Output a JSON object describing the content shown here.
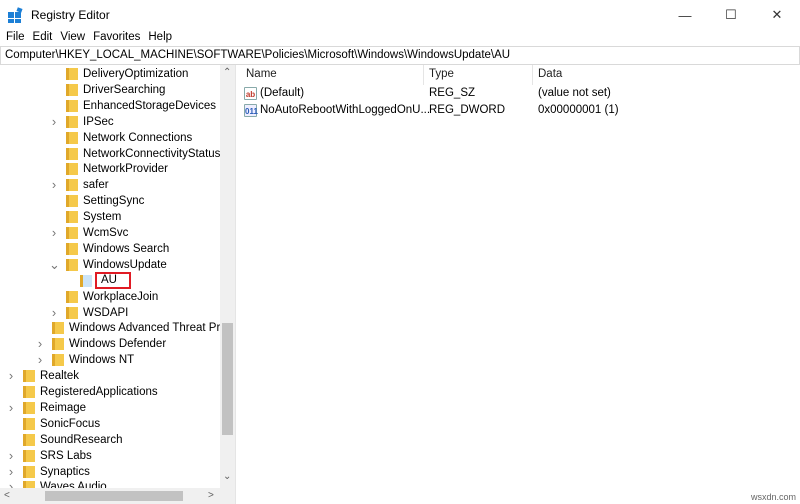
{
  "window": {
    "title": "Registry Editor",
    "minimize": "—",
    "maximize": "☐",
    "close": "✕"
  },
  "menu": [
    "File",
    "Edit",
    "View",
    "Favorites",
    "Help"
  ],
  "address": "Computer\\HKEY_LOCAL_MACHINE\\SOFTWARE\\Policies\\Microsoft\\Windows\\WindowsUpdate\\AU",
  "tree": [
    {
      "label": "DeliveryOptimization",
      "level": 3,
      "expander": "none"
    },
    {
      "label": "DriverSearching",
      "level": 3,
      "expander": "none"
    },
    {
      "label": "EnhancedStorageDevices",
      "level": 3,
      "expander": "none"
    },
    {
      "label": "IPSec",
      "level": 3,
      "expander": "collapsed"
    },
    {
      "label": "Network Connections",
      "level": 3,
      "expander": "none"
    },
    {
      "label": "NetworkConnectivityStatusInd",
      "level": 3,
      "expander": "none"
    },
    {
      "label": "NetworkProvider",
      "level": 3,
      "expander": "none"
    },
    {
      "label": "safer",
      "level": 3,
      "expander": "collapsed"
    },
    {
      "label": "SettingSync",
      "level": 3,
      "expander": "none"
    },
    {
      "label": "System",
      "level": 3,
      "expander": "none"
    },
    {
      "label": "WcmSvc",
      "level": 3,
      "expander": "collapsed"
    },
    {
      "label": "Windows Search",
      "level": 3,
      "expander": "none"
    },
    {
      "label": "WindowsUpdate",
      "level": 3,
      "expander": "expanded"
    },
    {
      "label": "AU",
      "level": 4,
      "expander": "none",
      "selected": true
    },
    {
      "label": "WorkplaceJoin",
      "level": 3,
      "expander": "none"
    },
    {
      "label": "WSDAPI",
      "level": 3,
      "expander": "collapsed"
    },
    {
      "label": "Windows Advanced Threat Prote",
      "level": 2,
      "expander": "none"
    },
    {
      "label": "Windows Defender",
      "level": 2,
      "expander": "collapsed"
    },
    {
      "label": "Windows NT",
      "level": 2,
      "expander": "collapsed"
    },
    {
      "label": "Realtek",
      "level": 0,
      "expander": "collapsed"
    },
    {
      "label": "RegisteredApplications",
      "level": 0,
      "expander": "none"
    },
    {
      "label": "Reimage",
      "level": 0,
      "expander": "collapsed"
    },
    {
      "label": "SonicFocus",
      "level": 0,
      "expander": "none"
    },
    {
      "label": "SoundResearch",
      "level": 0,
      "expander": "none"
    },
    {
      "label": "SRS Labs",
      "level": 0,
      "expander": "collapsed"
    },
    {
      "label": "Synaptics",
      "level": 0,
      "expander": "collapsed"
    },
    {
      "label": "Waves Audio",
      "level": 0,
      "expander": "collapsed"
    }
  ],
  "list": {
    "columns": [
      "Name",
      "Type",
      "Data"
    ],
    "rows": [
      {
        "icon": "string-value-icon",
        "icon_text": "ab",
        "name": "(Default)",
        "type": "REG_SZ",
        "data": "(value not set)"
      },
      {
        "icon": "dword-value-icon",
        "icon_text": "011",
        "name": "NoAutoRebootWithLoggedOnU...",
        "type": "REG_DWORD",
        "data": "0x00000001 (1)"
      }
    ]
  },
  "watermark": "wsxdn.com",
  "colors": {
    "selection_outline": "#e01b24",
    "folder": "#f5c94a",
    "app_icon": "#1c7fd6"
  }
}
